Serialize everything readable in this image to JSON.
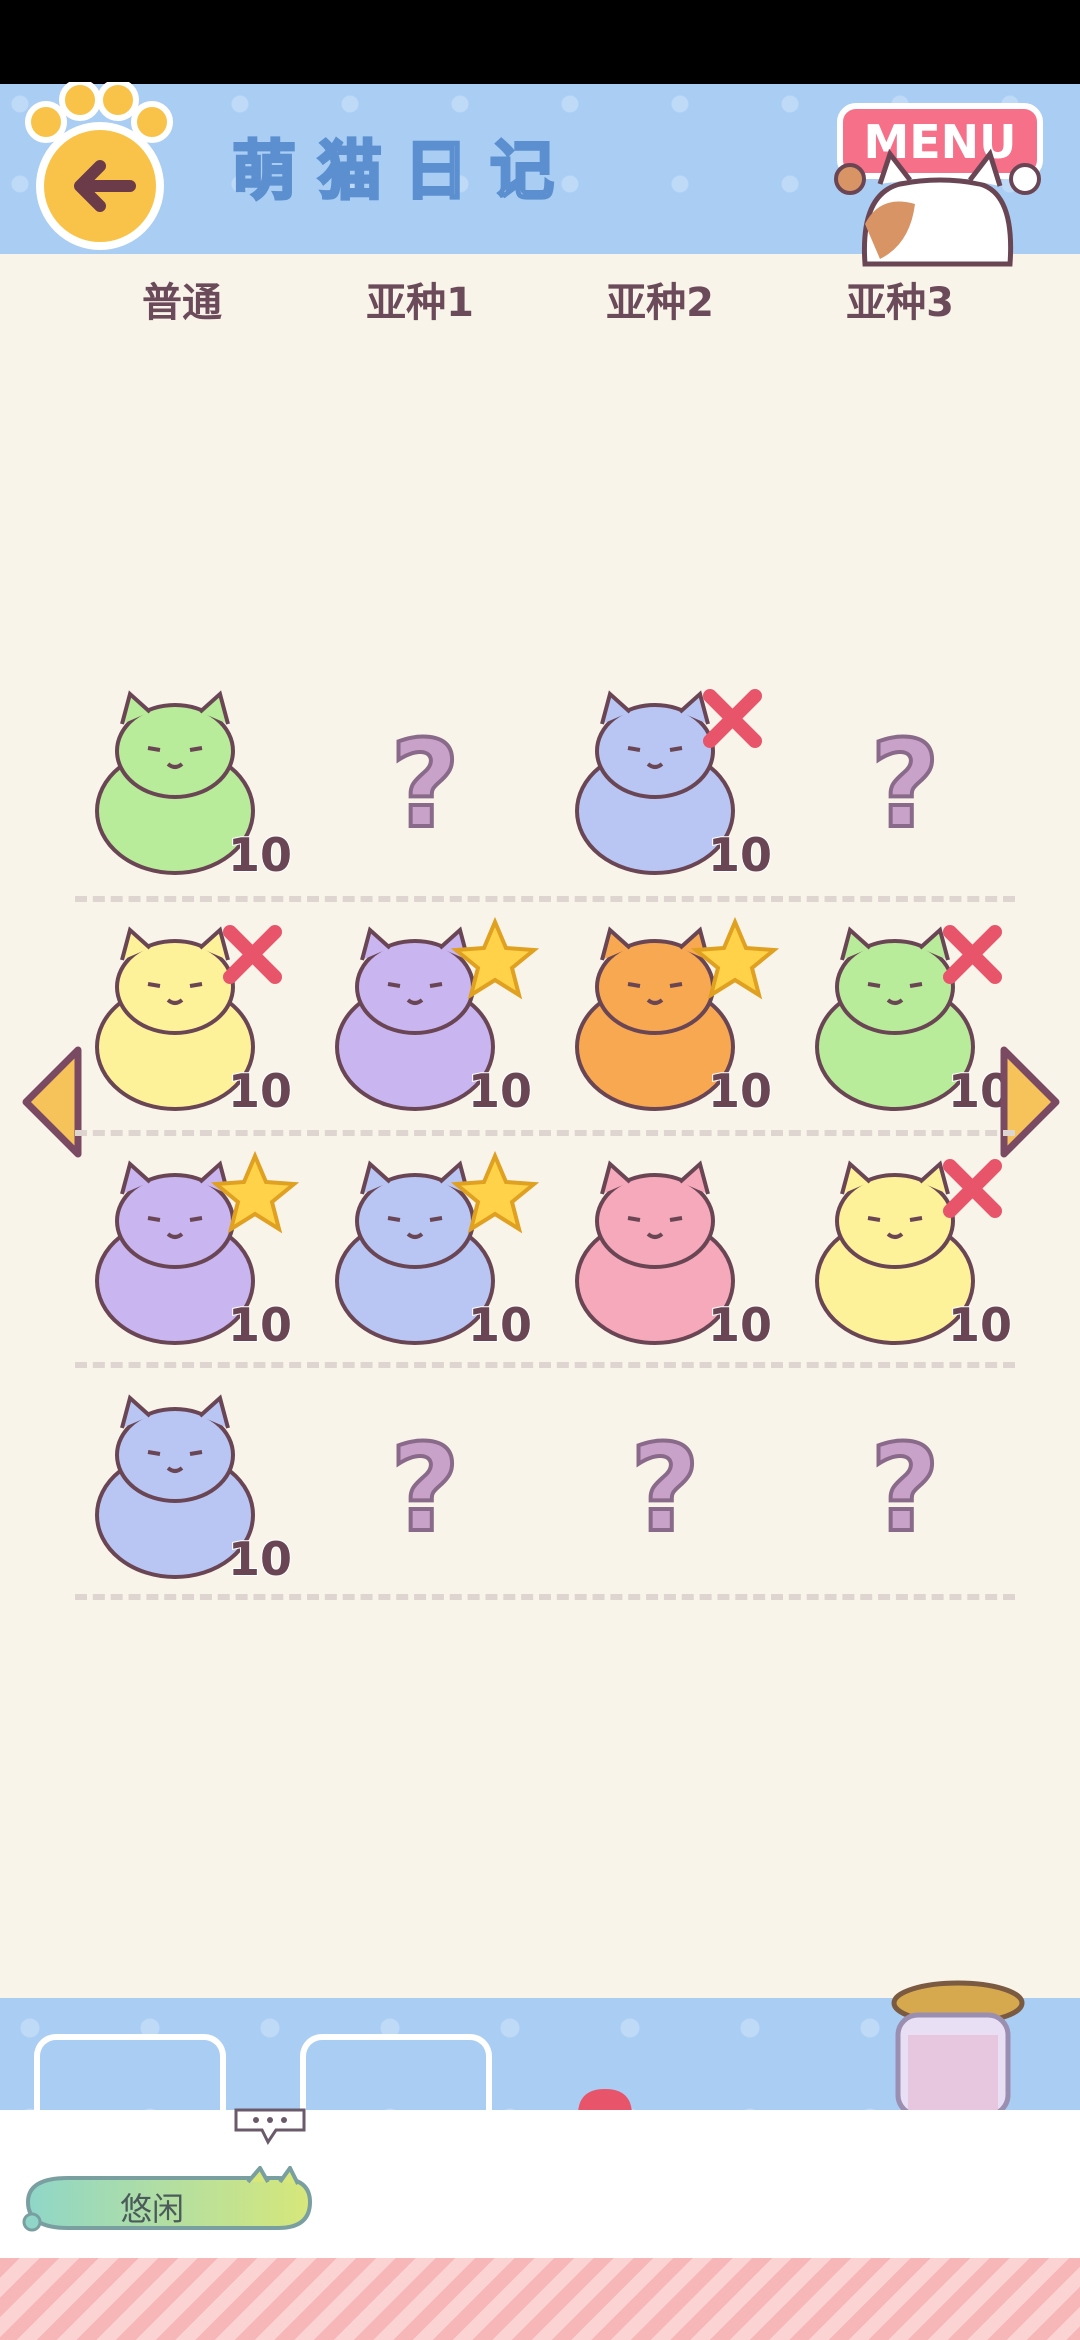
{
  "header": {
    "title": "萌猫日记",
    "menu_label": "MENU"
  },
  "tabs": [
    "普通",
    "亚种1",
    "亚种2",
    "亚种3"
  ],
  "grid": {
    "rows": [
      [
        {
          "kind": "cat",
          "desc": "pirate-cat-green",
          "count": "10",
          "badge": "none"
        },
        {
          "kind": "unknown",
          "symbol": "?"
        },
        {
          "kind": "cat",
          "desc": "pirate-cat-blue",
          "count": "10",
          "badge": "cross"
        },
        {
          "kind": "unknown",
          "symbol": "?"
        }
      ],
      [
        {
          "kind": "cat",
          "desc": "fat-cat-yellow",
          "count": "10",
          "badge": "cross"
        },
        {
          "kind": "cat",
          "desc": "sumo-cat-purple",
          "count": "10",
          "badge": "star"
        },
        {
          "kind": "cat",
          "desc": "sumo-cat-orange",
          "count": "10",
          "badge": "star"
        },
        {
          "kind": "cat",
          "desc": "fat-cat-green",
          "count": "10",
          "badge": "cross"
        }
      ],
      [
        {
          "kind": "cat",
          "desc": "chef-cat-purple",
          "count": "10",
          "badge": "star"
        },
        {
          "kind": "cat",
          "desc": "chef-cat-blue",
          "count": "10",
          "badge": "star"
        },
        {
          "kind": "cat",
          "desc": "chef-cat-pink",
          "count": "10",
          "badge": "none"
        },
        {
          "kind": "cat",
          "desc": "chef-cat-yellow",
          "count": "10",
          "badge": "cross"
        }
      ],
      [
        {
          "kind": "cat",
          "desc": "sleeping-cat-blue",
          "count": "10",
          "badge": "none"
        },
        {
          "kind": "unknown",
          "symbol": "?"
        },
        {
          "kind": "unknown",
          "symbol": "?"
        },
        {
          "kind": "unknown",
          "symbol": "?"
        }
      ]
    ]
  },
  "bottom": {
    "idle_label": "悠闲"
  },
  "colors": {
    "header_bg": "#a9cdf3",
    "page_bg": "#f8f4ea",
    "tab_text": "#6b4a5a",
    "count_text": "#6a4655",
    "question_mark": "#c9a2c9",
    "star": "#ffd24a",
    "cross": "#e8546a"
  }
}
